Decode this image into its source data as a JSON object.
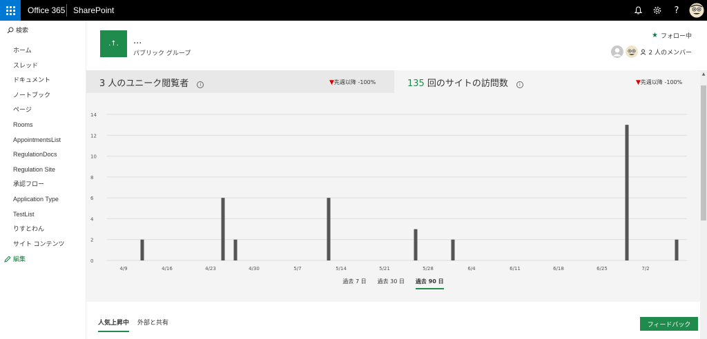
{
  "topbar": {
    "brand": "Office 365",
    "app": "SharePoint",
    "icons": [
      "bell-icon",
      "gear-icon",
      "help-icon"
    ]
  },
  "sidebar": {
    "search_label": "検索",
    "items": [
      {
        "label": "ホーム"
      },
      {
        "label": "スレッド"
      },
      {
        "label": "ドキュメント"
      },
      {
        "label": "ノートブック"
      },
      {
        "label": "ページ"
      },
      {
        "label": "Rooms"
      },
      {
        "label": "AppointmentsList"
      },
      {
        "label": "RegulationDocs"
      },
      {
        "label": "Regulation Site"
      },
      {
        "label": "承認フロー"
      },
      {
        "label": "Application Type"
      },
      {
        "label": "TestList"
      },
      {
        "label": "りすとわん"
      },
      {
        "label": "サイト コンテンツ"
      }
    ],
    "edit_label": "編集"
  },
  "site": {
    "logo_text": ".↑.",
    "title": "...",
    "subtitle": "パブリック グループ",
    "follow_label": "フォロー中",
    "members_label": "2 人のメンバー"
  },
  "stats": {
    "unique_viewers": {
      "number": "3",
      "label": "人のユニーク閲覧者",
      "change": "先週以降 -100%"
    },
    "site_visits": {
      "number": "135",
      "label": "回のサイトの訪問数",
      "change": "先週以降 -100%"
    }
  },
  "chart_data": {
    "type": "bar",
    "ylim": [
      0,
      14
    ],
    "yticks": [
      0,
      2,
      4,
      6,
      8,
      10,
      12,
      14
    ],
    "xtick_labels": [
      "4/9",
      "4/16",
      "4/23",
      "4/30",
      "5/7",
      "5/14",
      "5/21",
      "5/28",
      "6/4",
      "6/11",
      "6/18",
      "6/25",
      "7/2"
    ],
    "grid": true,
    "bars": [
      {
        "date": "4/12",
        "value": 2
      },
      {
        "date": "4/25",
        "value": 6
      },
      {
        "date": "4/27",
        "value": 2
      },
      {
        "date": "5/12",
        "value": 6
      },
      {
        "date": "5/26",
        "value": 3
      },
      {
        "date": "6/1",
        "value": 2
      },
      {
        "date": "6/29",
        "value": 13
      },
      {
        "date": "7/7",
        "value": 2
      }
    ]
  },
  "ranges": [
    {
      "label": "過去 7 日",
      "active": false
    },
    {
      "label": "過去 30 日",
      "active": false
    },
    {
      "label": "過去 90 日",
      "active": true
    }
  ],
  "tabs": [
    {
      "label": "人気上昇中",
      "active": true
    },
    {
      "label": "外部と共有",
      "active": false
    }
  ],
  "feedback_label": "フィードバック",
  "colors": {
    "accent": "#1f8b4c",
    "topbar": "#000000",
    "waffle": "#0078d4",
    "bar": "#555555",
    "down": "#dd0000"
  }
}
